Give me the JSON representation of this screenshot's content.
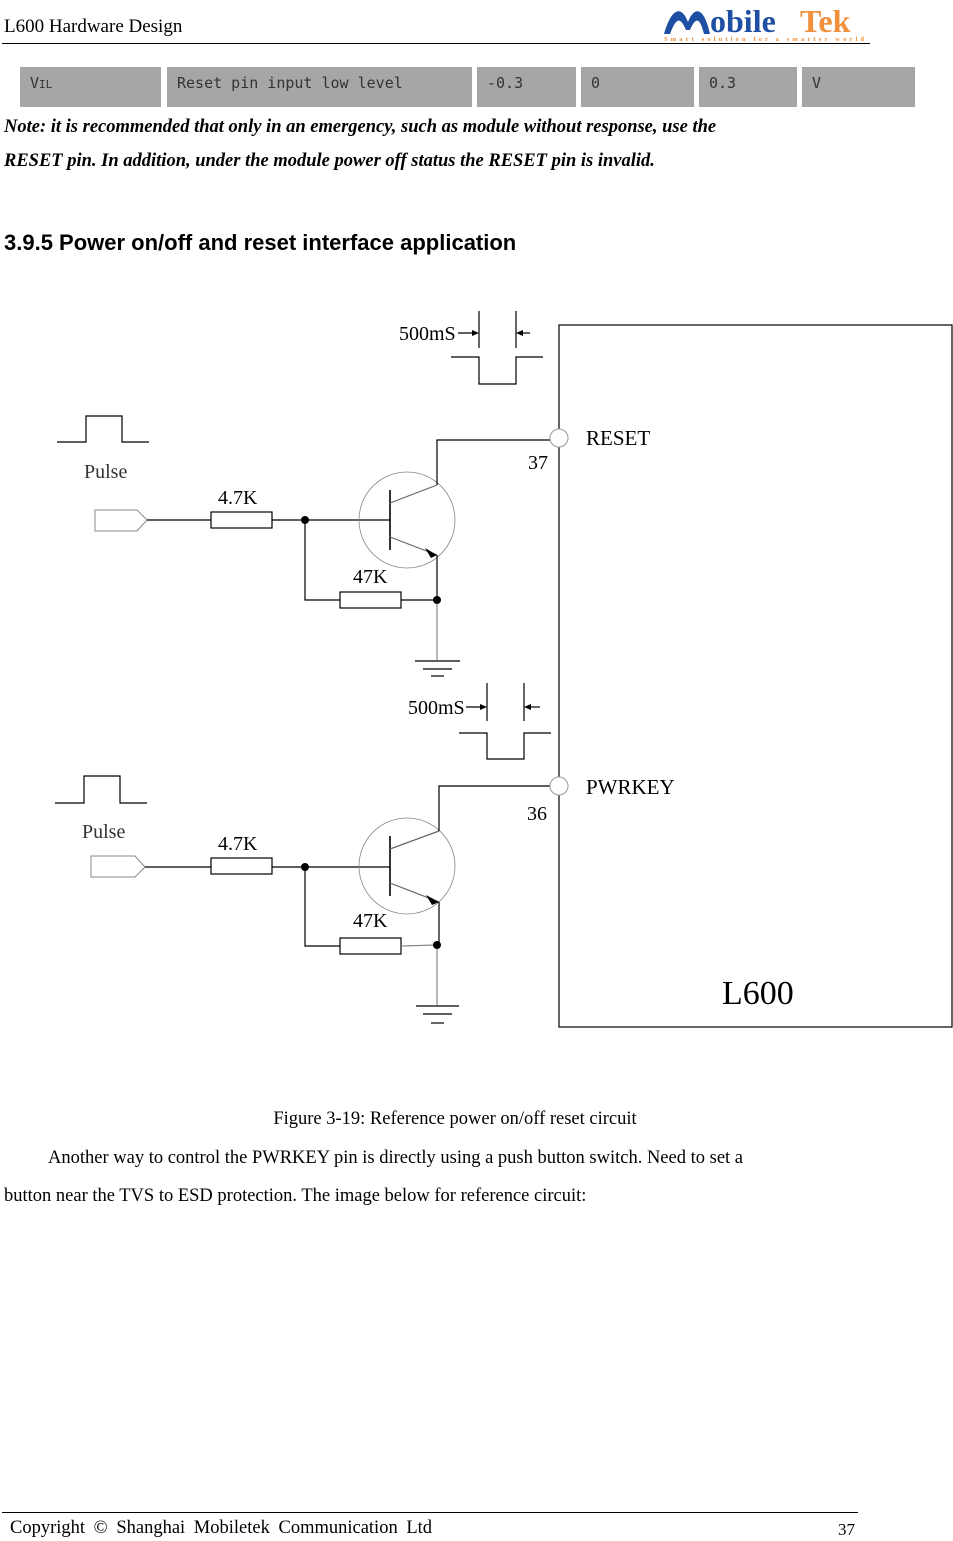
{
  "header": {
    "doc_title": "L600 Hardware Design",
    "logo": {
      "text_left": "Mobile",
      "text_right": "Tek",
      "tagline": "Smart solution for a smarter world",
      "color_primary": "#1f4fa3",
      "color_accent": "#f0903a"
    }
  },
  "table_row": {
    "symbol": "VIL",
    "symbol_main": "V",
    "symbol_sub": "IL",
    "description": "Reset pin input low level",
    "min": "-0.3",
    "typ": "0",
    "max": "0.3",
    "unit": "V",
    "cell_color": "#a6a6a6"
  },
  "note": {
    "line1": "Note: it is recommended that only in an emergency, such as module without response, use the",
    "line2": "RESET pin. In addition, under the module power off status the RESET pin is invalid."
  },
  "section": {
    "heading": "3.9.5 Power on/off and reset interface application"
  },
  "schematic": {
    "module_label": "L600",
    "circuits": [
      {
        "pin_name": "RESET",
        "pin_number": "37",
        "pulse_label": "Pulse",
        "timing_label": "500mS",
        "series_resistor": "4.7K",
        "pulldown_resistor": "47K"
      },
      {
        "pin_name": "PWRKEY",
        "pin_number": "36",
        "pulse_label": "Pulse",
        "timing_label": "500mS",
        "series_resistor": "4.7K",
        "pulldown_resistor": "47K"
      }
    ]
  },
  "figure": {
    "caption": "Figure 3-19: Reference power on/off reset circuit"
  },
  "body": {
    "para_line1": "Another way to control the PWRKEY pin is directly using a push button switch. Need to set a",
    "para_line2": "button near the TVS to ESD protection. The image below for reference circuit:"
  },
  "footer": {
    "copyright": "Copyright © Shanghai Mobiletek Communication Ltd",
    "page_number": "37"
  }
}
